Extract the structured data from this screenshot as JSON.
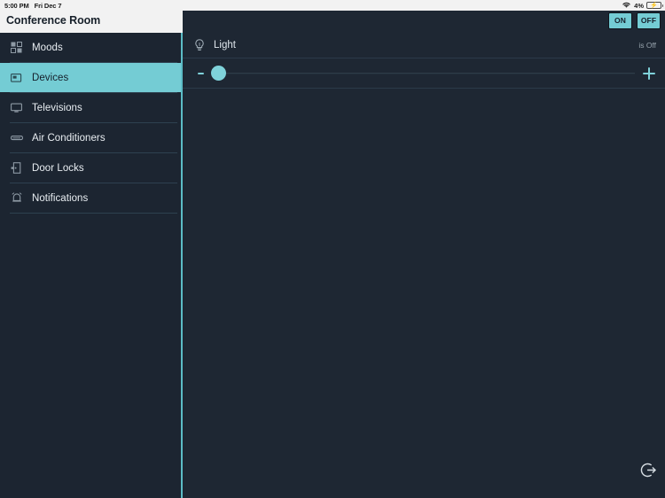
{
  "statusbar": {
    "time": "5:00 PM",
    "date": "Fri Dec 7",
    "battery_percent": "4%",
    "wifi_icon": "wifi-icon",
    "battery_icon": "battery-charging-icon"
  },
  "titlebar": {
    "title": "Conference Room",
    "toggles": [
      {
        "label": "ON",
        "name": "power-on-button"
      },
      {
        "label": "OFF",
        "name": "power-off-button"
      }
    ]
  },
  "sidebar": {
    "items": [
      {
        "label": "Moods",
        "icon": "moods-icon",
        "name": "sidebar-item-moods",
        "active": false
      },
      {
        "label": "Devices",
        "icon": "devices-icon",
        "name": "sidebar-item-devices",
        "active": true
      },
      {
        "label": "Televisions",
        "icon": "television-icon",
        "name": "sidebar-item-televisions",
        "active": false
      },
      {
        "label": "Air Conditioners",
        "icon": "air-conditioner-icon",
        "name": "sidebar-item-air-conditioners",
        "active": false
      },
      {
        "label": "Door Locks",
        "icon": "door-lock-icon",
        "name": "sidebar-item-door-locks",
        "active": false
      },
      {
        "label": "Notifications",
        "icon": "notification-bell-icon",
        "name": "sidebar-item-notifications",
        "active": false
      }
    ]
  },
  "content": {
    "device": {
      "icon": "lightbulb-icon",
      "name": "Light",
      "state": "is Off",
      "slider": {
        "value": 0,
        "min": 0,
        "max": 100,
        "decrease_icon": "minus-icon",
        "increase_icon": "plus-icon"
      }
    },
    "logout_icon": "logout-icon"
  },
  "colors": {
    "accent": "#74ccd4",
    "background": "#1e2733",
    "sidebar_background": "#1c2531",
    "statusbar_background": "#f2f2f2",
    "text_primary": "#e9eef2",
    "text_muted": "#97a3ad",
    "divider": "#2b3a49"
  }
}
